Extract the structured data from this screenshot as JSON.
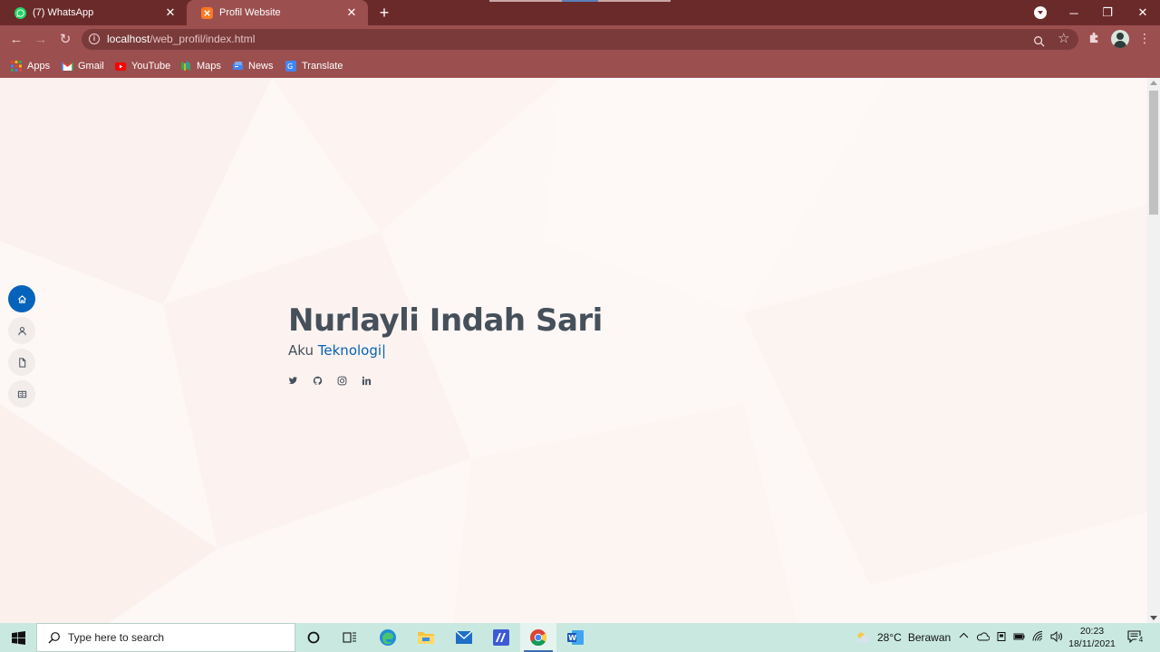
{
  "browser": {
    "tabs": [
      {
        "title": "(7) WhatsApp",
        "active": false,
        "icon": "whatsapp-icon"
      },
      {
        "title": "Profil Website",
        "active": true,
        "icon": "xampp-icon"
      }
    ],
    "url_host": "localhost",
    "url_path": "/web_profil/index.html",
    "bookmarks": [
      {
        "label": "Apps",
        "icon": "apps-grid-icon"
      },
      {
        "label": "Gmail",
        "icon": "gmail-icon"
      },
      {
        "label": "YouTube",
        "icon": "youtube-icon"
      },
      {
        "label": "Maps",
        "icon": "maps-icon"
      },
      {
        "label": "News",
        "icon": "news-icon"
      },
      {
        "label": "Translate",
        "icon": "translate-icon"
      }
    ],
    "colors": {
      "frame": "#6b2a2a",
      "toolbar": "#9c4f4f"
    }
  },
  "page": {
    "name": "Nurlayli Indah Sari",
    "intro": "Aku",
    "typed": "Teknologi",
    "cursor": "|",
    "accent": "#0563bb",
    "text_color": "#45505b",
    "nav": [
      "home-icon",
      "person-icon",
      "file-icon",
      "book-icon"
    ],
    "social": [
      "twitter-icon",
      "github-icon",
      "instagram-icon",
      "linkedin-icon"
    ]
  },
  "taskbar": {
    "search_placeholder": "Type here to search",
    "weather_temp": "28°C",
    "weather_text": "Berawan",
    "time": "20:23",
    "date": "18/11/2021",
    "notifications": "4"
  }
}
